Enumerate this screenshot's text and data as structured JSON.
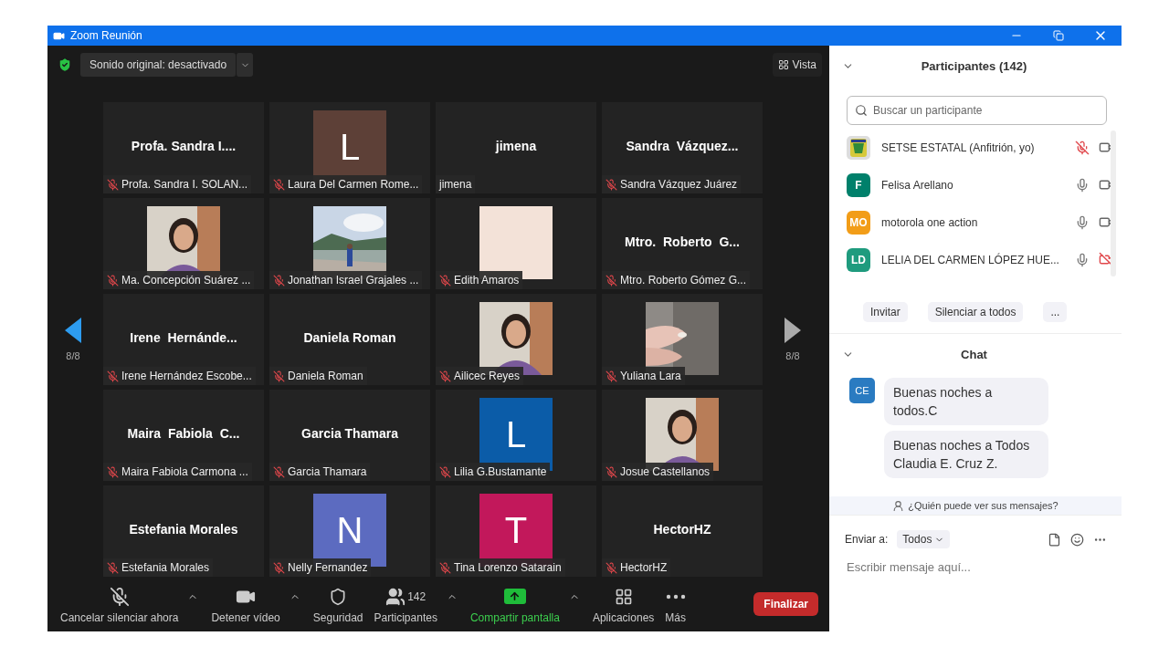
{
  "window": {
    "title": "Zoom Reunión"
  },
  "top_bar": {
    "audio_button": "Sonido original: desactivado",
    "view_button": "Vista"
  },
  "pager": {
    "left": "8/8",
    "right": "8/8"
  },
  "tiles": [
    {
      "kind": "name",
      "display": "Profa. Sandra I....",
      "label": "Profa. Sandra I. SOLAN...",
      "muted": true
    },
    {
      "kind": "letter",
      "display": "L",
      "color": "#5d4037",
      "label": "Laura Del Carmen Rome...",
      "muted": true
    },
    {
      "kind": "name",
      "display": "jimena",
      "label": "jimena",
      "muted": false
    },
    {
      "kind": "name",
      "display": "Sandra  Vázquez...",
      "label": "Sandra Vázquez Juárez",
      "muted": true
    },
    {
      "kind": "picture",
      "label": "Ma. Concepción Suárez ...",
      "muted": true
    },
    {
      "kind": "picture",
      "label": "Jonathan Israel Grajales ...",
      "muted": true
    },
    {
      "kind": "swatch",
      "color": "#f3e2d8",
      "label": "Edith Amaros",
      "muted": true
    },
    {
      "kind": "name",
      "display": "Mtro.  Roberto  G...",
      "label": "Mtro. Roberto Gómez G...",
      "muted": true
    },
    {
      "kind": "name",
      "display": "Irene  Hernánde...",
      "label": "Irene Hernández Escobe...",
      "muted": true
    },
    {
      "kind": "name",
      "display": "Daniela Roman",
      "label": "Daniela Roman",
      "muted": true
    },
    {
      "kind": "picture",
      "label": "Ailicec Reyes",
      "muted": true
    },
    {
      "kind": "picture",
      "label": "Yuliana Lara",
      "muted": true
    },
    {
      "kind": "name",
      "display": "Maira  Fabiola  C...",
      "label": "Maira Fabiola Carmona ...",
      "muted": true
    },
    {
      "kind": "name",
      "display": "Garcia Thamara",
      "label": "Garcia Thamara",
      "muted": true
    },
    {
      "kind": "letter",
      "display": "L",
      "color": "#0b5ca8",
      "label": "Lilia G.Bustamante",
      "muted": true
    },
    {
      "kind": "picture",
      "label": "Josue Castellanos",
      "muted": true
    },
    {
      "kind": "name",
      "display": "Estefania Morales",
      "label": "Estefania Morales",
      "muted": true
    },
    {
      "kind": "letter",
      "display": "N",
      "color": "#5c6bc0",
      "label": "Nelly Fernandez",
      "muted": true
    },
    {
      "kind": "letter",
      "display": "T",
      "color": "#c2185b",
      "label": "Tina Lorenzo Satarain",
      "muted": true
    },
    {
      "kind": "name",
      "display": "HectorHZ",
      "label": "HectorHZ",
      "muted": true
    }
  ],
  "toolbar": [
    {
      "kind": "mic",
      "label": "Cancelar silenciar ahora",
      "caret": true,
      "highlight": false
    },
    {
      "kind": "video",
      "label": "Detener vídeo",
      "caret": true,
      "highlight": false
    },
    {
      "kind": "security",
      "label": "Seguridad",
      "caret": false,
      "highlight": false
    },
    {
      "kind": "participants",
      "label": "Participantes",
      "count": "142",
      "caret": true,
      "highlight": false
    },
    {
      "kind": "share",
      "label": "Compartir pantalla",
      "caret": true,
      "highlight": true
    },
    {
      "kind": "apps",
      "label": "Aplicaciones",
      "caret": false,
      "highlight": false
    },
    {
      "kind": "more",
      "label": "Más",
      "caret": false,
      "highlight": false
    }
  ],
  "end_button": "Finalizar",
  "participants_panel": {
    "title": "Participantes (142)",
    "search": {
      "placeholder": "Buscar un participante"
    },
    "items": [
      {
        "kind": "picture",
        "name": "SETSE ESTATAL (Anfitrión, yo)",
        "mic_muted": true,
        "video_off": false
      },
      {
        "kind": "letter",
        "initials": "F",
        "color": "#00806b",
        "name": "Felisa Arellano",
        "mic_muted": false,
        "video_off": false
      },
      {
        "kind": "letter",
        "initials": "MO",
        "color": "#f29d18",
        "name": "motorola one action",
        "mic_muted": false,
        "video_off": false
      },
      {
        "kind": "letter",
        "initials": "LD",
        "color": "#1f9b7e",
        "name": "LELIA DEL CARMEN LÓPEZ HUE...",
        "mic_muted": false,
        "video_off": true
      }
    ],
    "buttons": [
      "Invitar",
      "Silenciar a todos",
      "..."
    ]
  },
  "chat": {
    "title": "Chat",
    "messages": [
      {
        "initials": "CE",
        "texts": [
          "Buenas noches a todos.C",
          "Buenas noches a Todos Claudia E. Cruz Z."
        ]
      }
    ],
    "privacy_note": "¿Quién puede ver sus mensajes?",
    "send_to_label": "Enviar a:",
    "send_to_value": "Todos",
    "input": {
      "placeholder": "Escribir mensaje aquí..."
    }
  }
}
